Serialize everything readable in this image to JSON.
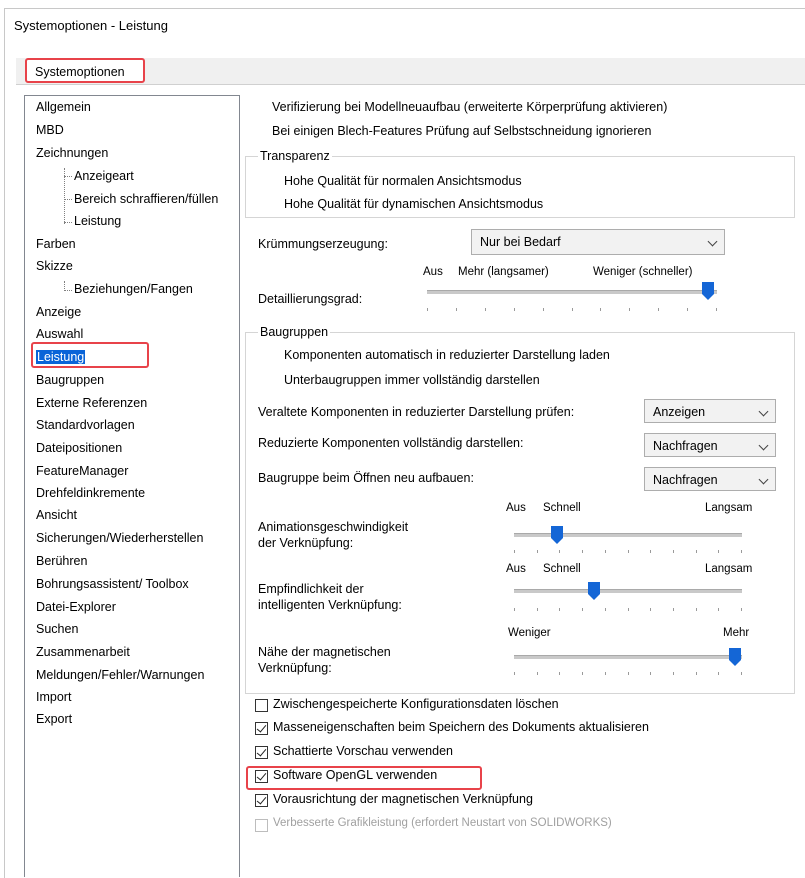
{
  "window": {
    "title": "Systemoptionen - Leistung"
  },
  "tab": {
    "label": "Systemoptionen"
  },
  "sidebar": {
    "items": [
      {
        "label": "Allgemein",
        "indent": 0
      },
      {
        "label": "MBD",
        "indent": 0
      },
      {
        "label": "Zeichnungen",
        "indent": 0
      },
      {
        "label": "Anzeigeart",
        "indent": 1
      },
      {
        "label": "Bereich schraffieren/füllen",
        "indent": 1
      },
      {
        "label": "Leistung",
        "indent": 1
      },
      {
        "label": "Farben",
        "indent": 0
      },
      {
        "label": "Skizze",
        "indent": 0
      },
      {
        "label": "Beziehungen/Fangen",
        "indent": 1
      },
      {
        "label": "Anzeige",
        "indent": 0
      },
      {
        "label": "Auswahl",
        "indent": 0
      },
      {
        "label": "Leistung",
        "indent": 0,
        "selected": true
      },
      {
        "label": "Baugruppen",
        "indent": 0
      },
      {
        "label": "Externe Referenzen",
        "indent": 0
      },
      {
        "label": "Standardvorlagen",
        "indent": 0
      },
      {
        "label": "Dateipositionen",
        "indent": 0
      },
      {
        "label": "FeatureManager",
        "indent": 0
      },
      {
        "label": "Drehfeldinkremente",
        "indent": 0
      },
      {
        "label": "Ansicht",
        "indent": 0
      },
      {
        "label": "Sicherungen/Wiederherstellen",
        "indent": 0
      },
      {
        "label": "Berühren",
        "indent": 0
      },
      {
        "label": "Bohrungsassistent/ Toolbox",
        "indent": 0
      },
      {
        "label": "Datei-Explorer",
        "indent": 0
      },
      {
        "label": "Suchen",
        "indent": 0
      },
      {
        "label": "Zusammenarbeit",
        "indent": 0
      },
      {
        "label": "Meldungen/Fehler/Warnungen",
        "indent": 0
      },
      {
        "label": "Import",
        "indent": 0
      },
      {
        "label": "Export",
        "indent": 0
      }
    ]
  },
  "main": {
    "verify_text": "Verifizierung bei Modellneuaufbau (erweiterte Körperprüfung aktivieren)",
    "sheetmetal_text": "Bei einigen Blech-Features Prüfung auf Selbstschneidung ignorieren",
    "transparency": {
      "legend": "Transparenz",
      "normal": "Hohe Qualität für normalen Ansichtsmodus",
      "dynamic": "Hohe Qualität für dynamischen Ansichtsmodus"
    },
    "curvature": {
      "label": "Krümmungserzeugung:",
      "value": "Nur bei Bedarf"
    },
    "detail": {
      "label": "Detaillierungsgrad:",
      "off": "Aus",
      "more": "Mehr (langsamer)",
      "less": "Weniger (schneller)",
      "level": 0.97
    },
    "assemblies": {
      "legend": "Baugruppen",
      "auto_load": "Komponenten automatisch in reduzierter Darstellung laden",
      "subassemblies": "Unterbaugruppen immer vollständig darstellen",
      "check_outdated": {
        "label": "Veraltete Komponenten in reduzierter Darstellung prüfen:",
        "value": "Anzeigen"
      },
      "resolve": {
        "label": "Reduzierte Komponenten vollständig darstellen:",
        "value": "Nachfragen"
      },
      "rebuild": {
        "label": "Baugruppe beim Öffnen neu aufbauen:",
        "value": "Nachfragen"
      },
      "anim_speed": {
        "label1": "Animationsgeschwindigkeit",
        "label2": "der Verknüpfung:",
        "off": "Aus",
        "fast": "Schnell",
        "slow": "Langsam",
        "level": 0.19
      },
      "smartmate": {
        "label1": "Empfindlichkeit der",
        "label2": "intelligenten Verknüpfung:",
        "off": "Aus",
        "fast": "Schnell",
        "slow": "Langsam",
        "level": 0.35
      },
      "magnetic": {
        "label1": "Nähe der magnetischen",
        "label2": "Verknüpfung:",
        "less": "Weniger",
        "more": "Mehr",
        "level": 0.97
      }
    },
    "checkboxes": [
      {
        "label": "Zwischengespeicherte Konfigurationsdaten löschen",
        "checked": false
      },
      {
        "label": "Masseneigenschaften beim Speichern des Dokuments aktualisieren",
        "checked": true
      },
      {
        "label": "Schattierte Vorschau verwenden",
        "checked": true
      },
      {
        "label": "Software OpenGL verwenden",
        "checked": true
      },
      {
        "label": "Vorausrichtung der magnetischen Verknüpfung",
        "checked": true
      },
      {
        "label": "Verbesserte Grafikleistung (erfordert Neustart von SOLIDWORKS)",
        "checked": false,
        "disabled": true
      }
    ]
  },
  "colors": {
    "selection": "#0a64d8",
    "highlight": "#e8434a",
    "thumb": "#1466d6"
  }
}
